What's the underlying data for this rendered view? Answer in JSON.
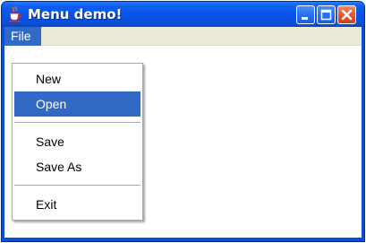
{
  "window": {
    "title": "Menu demo!",
    "icon": "java-cup-icon",
    "controls": [
      "minimize-icon",
      "maximize-icon",
      "close-icon"
    ]
  },
  "menubar": {
    "items": [
      {
        "label": "File",
        "active": true
      }
    ]
  },
  "file_menu": {
    "items": [
      {
        "label": "New",
        "selected": false
      },
      {
        "label": "Open",
        "selected": true
      },
      {
        "label": "Save",
        "selected": false
      },
      {
        "label": "Save As",
        "selected": false
      },
      {
        "label": "Exit",
        "selected": false
      }
    ]
  },
  "colors": {
    "titlebar": "#0a4fd8",
    "selection": "#316ac5",
    "menubar": "#ece9d8",
    "close_button": "#e35b32"
  }
}
